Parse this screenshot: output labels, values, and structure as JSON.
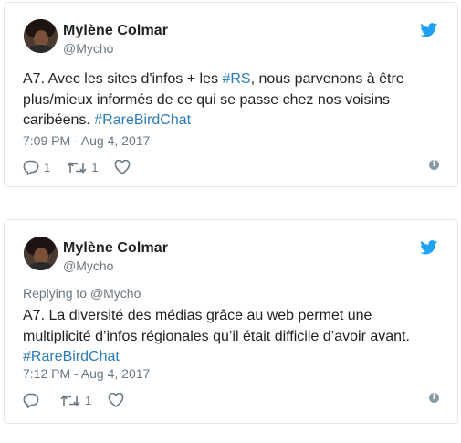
{
  "tweets": [
    {
      "author_name": "Mylène Colmar",
      "author_handle": "@Mycho",
      "reply_to": "",
      "text_parts": {
        "p1": "A7. Avec les sites d'infos + les ",
        "h1": "#RS",
        "p2": ", nous parvenons à être plus/mieux informés de ce qui se passe chez nos voisins caribéens. ",
        "h2": "#RareBirdChat"
      },
      "timestamp": "7:09 PM - Aug 4, 2017",
      "reply_count": "1",
      "retweet_count": "1",
      "like_count": ""
    },
    {
      "author_name": "Mylène Colmar",
      "author_handle": "@Mycho",
      "reply_to": "Replying to @Mycho",
      "text_parts": {
        "p1": "A7. La diversité des médias grâce au web permet une multiplicité d’infos régionales qu’il était difficile d’avoir avant. ",
        "h1": "#RareBirdChat"
      },
      "timestamp": "7:12 PM - Aug 4, 2017",
      "reply_count": "",
      "retweet_count": "1",
      "like_count": ""
    }
  ],
  "icons": {
    "brand": "twitter-bird-icon",
    "reply": "reply-icon",
    "retweet": "retweet-icon",
    "like": "heart-icon",
    "info": "info-icon"
  },
  "colors": {
    "brand": "#1da1f2",
    "link": "#2b7bb9",
    "muted": "#697882",
    "border": "#e1e8ed",
    "text": "#1c2022"
  }
}
